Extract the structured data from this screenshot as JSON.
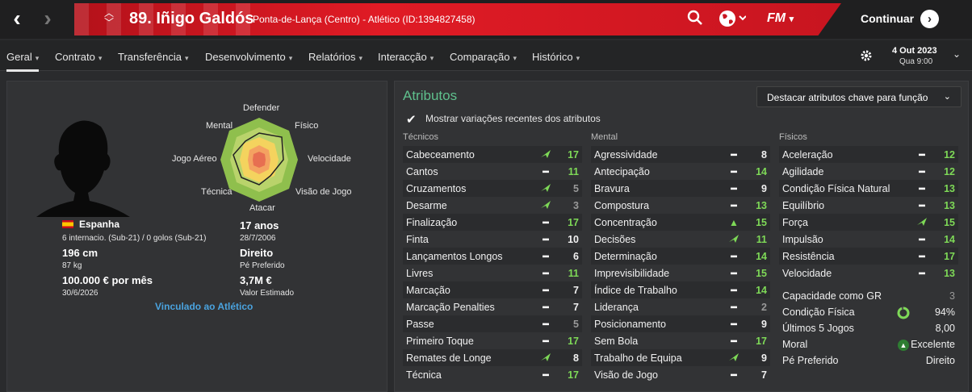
{
  "header": {
    "player_name": "89. Iñigo Galdós",
    "player_club": "Ponta-de-Lança (Centro) - Atlético (ID:1394827458)",
    "continue_label": "Continuar",
    "date": "4 Out 2023",
    "time": "Qua 9:00",
    "fm_logo": "FM"
  },
  "menu": [
    {
      "label": "Geral"
    },
    {
      "label": "Contrato"
    },
    {
      "label": "Transferência"
    },
    {
      "label": "Desenvolvimento"
    },
    {
      "label": "Relatórios"
    },
    {
      "label": "Interacção"
    },
    {
      "label": "Comparação"
    },
    {
      "label": "Histórico"
    }
  ],
  "profile": {
    "radar_labels": [
      "Defender",
      "Físico",
      "Velocidade",
      "Visão de Jogo",
      "Atacar",
      "Técnica",
      "Jogo Aéreo",
      "Mental"
    ],
    "nationality": "Espanha",
    "caps": "6 internacio. (Sub-21) / 0 golos (Sub-21)",
    "height": "196 cm",
    "weight": "87 kg",
    "wage": "100.000 € por mês",
    "contract_end": "30/6/2026",
    "age": "17 anos",
    "dob": "28/7/2006",
    "foot": "Direito",
    "foot_label": "Pé Preferido",
    "value": "3,7M €",
    "value_label": "Valor Estimado",
    "linked": "Vinculado ao Atlético"
  },
  "attributes": {
    "title": "Atributos",
    "dropdown": "Destacar atributos chave para função",
    "show_changes": "Mostrar variações recentes dos atributos",
    "technical_head": "Técnicos",
    "mental_head": "Mental",
    "physical_head": "Físicos",
    "technical": [
      {
        "name": "Cabeceamento",
        "val": "17",
        "ind": "up"
      },
      {
        "name": "Cantos",
        "val": "11",
        "ind": "flat"
      },
      {
        "name": "Cruzamentos",
        "val": "5",
        "ind": "up"
      },
      {
        "name": "Desarme",
        "val": "3",
        "ind": "up"
      },
      {
        "name": "Finalização",
        "val": "17",
        "ind": "flat"
      },
      {
        "name": "Finta",
        "val": "10",
        "ind": "flat"
      },
      {
        "name": "Lançamentos Longos",
        "val": "6",
        "ind": "flat"
      },
      {
        "name": "Livres",
        "val": "11",
        "ind": "flat"
      },
      {
        "name": "Marcação",
        "val": "7",
        "ind": "flat"
      },
      {
        "name": "Marcação Penalties",
        "val": "7",
        "ind": "flat"
      },
      {
        "name": "Passe",
        "val": "5",
        "ind": "flat"
      },
      {
        "name": "Primeiro Toque",
        "val": "17",
        "ind": "flat"
      },
      {
        "name": "Remates de Longe",
        "val": "8",
        "ind": "up"
      },
      {
        "name": "Técnica",
        "val": "17",
        "ind": "flat"
      }
    ],
    "mental": [
      {
        "name": "Agressividade",
        "val": "8",
        "ind": "flat"
      },
      {
        "name": "Antecipação",
        "val": "14",
        "ind": "flat"
      },
      {
        "name": "Bravura",
        "val": "9",
        "ind": "flat"
      },
      {
        "name": "Compostura",
        "val": "13",
        "ind": "flat"
      },
      {
        "name": "Concentração",
        "val": "15",
        "ind": "upv"
      },
      {
        "name": "Decisões",
        "val": "11",
        "ind": "up"
      },
      {
        "name": "Determinação",
        "val": "14",
        "ind": "flat"
      },
      {
        "name": "Imprevisibilidade",
        "val": "15",
        "ind": "flat"
      },
      {
        "name": "Índice de Trabalho",
        "val": "14",
        "ind": "flat"
      },
      {
        "name": "Liderança",
        "val": "2",
        "ind": "flat"
      },
      {
        "name": "Posicionamento",
        "val": "9",
        "ind": "flat"
      },
      {
        "name": "Sem Bola",
        "val": "17",
        "ind": "flat"
      },
      {
        "name": "Trabalho de Equipa",
        "val": "9",
        "ind": "up"
      },
      {
        "name": "Visão de Jogo",
        "val": "7",
        "ind": "flat"
      }
    ],
    "physical": [
      {
        "name": "Aceleração",
        "val": "12",
        "ind": "flat"
      },
      {
        "name": "Agilidade",
        "val": "12",
        "ind": "flat"
      },
      {
        "name": "Condição Física Natural",
        "val": "13",
        "ind": "flat"
      },
      {
        "name": "Equilíbrio",
        "val": "13",
        "ind": "flat"
      },
      {
        "name": "Força",
        "val": "15",
        "ind": "up"
      },
      {
        "name": "Impulsão",
        "val": "14",
        "ind": "flat"
      },
      {
        "name": "Resistência",
        "val": "17",
        "ind": "flat"
      },
      {
        "name": "Velocidade",
        "val": "13",
        "ind": "flat"
      }
    ],
    "extra": [
      {
        "name": "Capacidade como GR",
        "val": "3"
      },
      {
        "name": "Condição Física",
        "val": "94%"
      },
      {
        "name": "Últimos 5 Jogos",
        "val": "8,00"
      },
      {
        "name": "Moral",
        "val": "Excelente"
      },
      {
        "name": "Pé Preferido",
        "val": "Direito"
      }
    ]
  }
}
